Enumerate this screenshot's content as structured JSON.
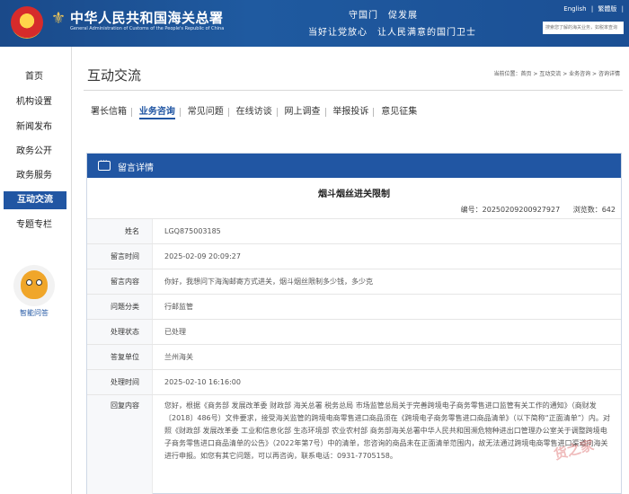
{
  "header": {
    "site_title": "中华人民共和国海关总署",
    "site_subtitle": "General Administration of Customs of the People's Republic of China",
    "slogan_line1": "守国门　促发展",
    "slogan_line2": "当好让党放心　让人民满意的国门卫士",
    "links": [
      "English",
      "|",
      "繁體版",
      "|"
    ],
    "search_placeholder": "搜索您了解的海关业务，如税率查询"
  },
  "sidebar": {
    "items": [
      {
        "label": "首页",
        "active": false
      },
      {
        "label": "机构设置",
        "active": false
      },
      {
        "label": "新闻发布",
        "active": false
      },
      {
        "label": "政务公开",
        "active": false
      },
      {
        "label": "政务服务",
        "active": false
      },
      {
        "label": "互动交流",
        "active": true
      },
      {
        "label": "专题专栏",
        "active": false
      }
    ],
    "assistant_label": "智能问答"
  },
  "main": {
    "heading": "互动交流",
    "breadcrumb": "当前位置：首页 > 互动交流 > 业务咨询 > 咨询详情",
    "tabs": [
      {
        "label": "署长信箱",
        "active": false
      },
      {
        "label": "业务咨询",
        "active": true
      },
      {
        "label": "常见问题",
        "active": false
      },
      {
        "label": "在线访谈",
        "active": false
      },
      {
        "label": "网上调查",
        "active": false
      },
      {
        "label": "举报投诉",
        "active": false
      },
      {
        "label": "意见征集",
        "active": false
      }
    ]
  },
  "panel": {
    "title": "留言详情",
    "message_title": "烟斗烟丝进关限制",
    "number": "编号：20250209200927927",
    "views": "浏览数：642",
    "rows": [
      {
        "label": "姓名",
        "value": "LGQ875003185"
      },
      {
        "label": "留言时间",
        "value": "2025-02-09 20:09:27"
      },
      {
        "label": "留言内容",
        "value": "你好，我想问下海淘邮寄方式进关，烟斗烟丝限制多少钱，多少克"
      },
      {
        "label": "问题分类",
        "value": "行邮监管"
      },
      {
        "label": "处理状态",
        "value": "已处理"
      },
      {
        "label": "答复单位",
        "value": "兰州海关"
      },
      {
        "label": "处理时间",
        "value": "2025-02-10 16:16:00"
      },
      {
        "label": "回复内容",
        "value": "您好，根据《商务部 发展改革委 财政部 海关总署 税务总局 市场监管总局关于完善跨境电子商务零售进口监管有关工作的通知》（商财发〔2018〕486号）文件要求，接受海关监管的跨境电商零售进口商品须在《跨境电子商务零售进口商品清单》（以下简称“正面清单”）内。对照《财政部 发展改革委 工业和信息化部 生态环境部 农业农村部 商务部海关总署中华人民共和国濒危物种进出口管理办公室关于调整跨境电子商务零售进口商品清单的公告》（2022年第7号）中的清单，您咨询的商品未在正面清单范围内，故无法通过跨境电商零售进口渠道向海关进行申报。如您有其它问题，可以再咨询，联系电话：0931-7705158。"
      }
    ]
  },
  "watermark": "货之家"
}
